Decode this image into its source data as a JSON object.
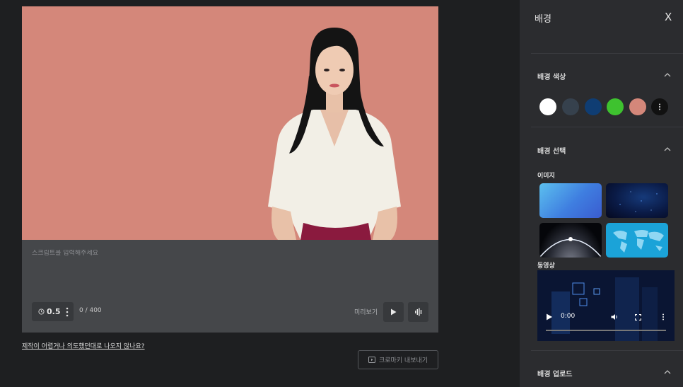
{
  "editor": {
    "script_placeholder": "스크립트를 입력해주세요",
    "speed_value": "0.5",
    "char_counter": "0 / 400",
    "preview_label": "미리보기",
    "help_link": "제작이 어렵거나 의도했던대로 나오지 않나요?",
    "export_label": "크로마키 내보내기",
    "preview_bg_color": "#d4877a"
  },
  "panel": {
    "title": "배경",
    "close_label": "X",
    "sections": {
      "color": "배경 색상",
      "select": "배경 선택",
      "upload": "배경 업로드"
    },
    "swatch_colors": [
      "#ffffff",
      "#36414d",
      "#0f3d73",
      "#3ec22f",
      "#d4877a",
      "#111111"
    ],
    "image_label": "이미지",
    "video_label": "동영상",
    "video_time": "0:00"
  }
}
